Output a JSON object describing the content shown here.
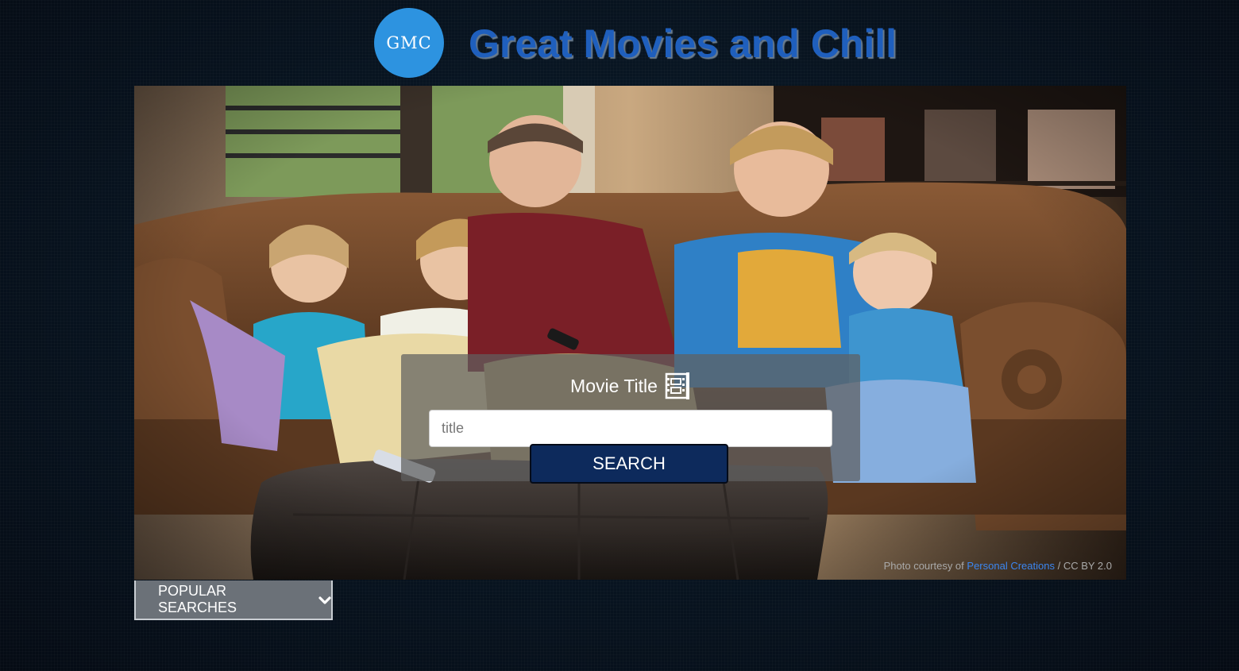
{
  "header": {
    "logo_text": "GMC",
    "title": "Great Movies and Chill"
  },
  "search": {
    "heading": "Movie Title",
    "heading_icon": "film-icon",
    "input_placeholder": "title",
    "input_value": "",
    "button_label": "SEARCH"
  },
  "credit": {
    "prefix": "Photo courtesy of",
    "link_text": "Personal Creations",
    "suffix": "/ CC BY 2.0"
  },
  "popular": {
    "label": "POPULAR SEARCHES",
    "icon": "chevron-down-icon"
  },
  "colors": {
    "logo_circle": "#2d93e0",
    "title_text": "#1f5fbd",
    "search_button": "#0d2a5c",
    "popular_button": "#6b7178",
    "credit_link": "#3b86f0"
  }
}
